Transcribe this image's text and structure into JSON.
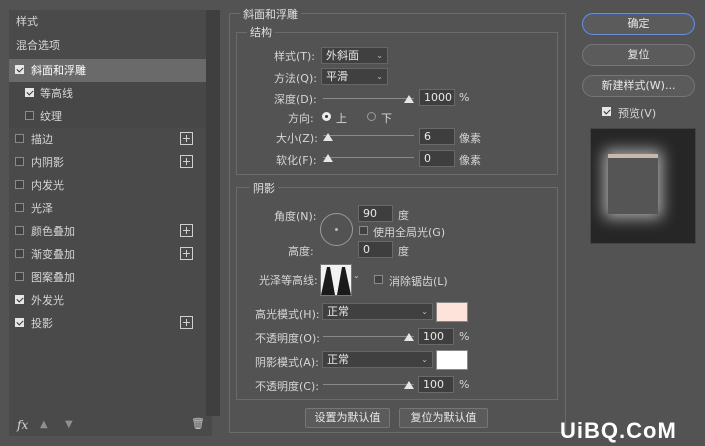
{
  "left_panel": {
    "header": "样式",
    "blend_options": "混合选项",
    "items": [
      {
        "label": "斜面和浮雕",
        "checked": true,
        "plus": false
      },
      {
        "label": "等高线",
        "checked": true,
        "plus": false
      },
      {
        "label": "纹理",
        "checked": false,
        "plus": false
      },
      {
        "label": "描边",
        "checked": false,
        "plus": true
      },
      {
        "label": "内阴影",
        "checked": false,
        "plus": true
      },
      {
        "label": "内发光",
        "checked": false,
        "plus": false
      },
      {
        "label": "光泽",
        "checked": false,
        "plus": false
      },
      {
        "label": "颜色叠加",
        "checked": false,
        "plus": true
      },
      {
        "label": "渐变叠加",
        "checked": false,
        "plus": true
      },
      {
        "label": "图案叠加",
        "checked": false,
        "plus": false
      },
      {
        "label": "外发光",
        "checked": true,
        "plus": false
      },
      {
        "label": "投影",
        "checked": true,
        "plus": true
      }
    ],
    "fx_label": "fx"
  },
  "bevel": {
    "section_title": "斜面和浮雕",
    "structure_title": "结构",
    "style_label": "样式(T):",
    "style_value": "外斜面",
    "technique_label": "方法(Q):",
    "technique_value": "平滑",
    "depth_label": "深度(D):",
    "depth_value": "1000",
    "depth_unit": "%",
    "direction_label": "方向:",
    "direction_up": "上",
    "direction_down": "下",
    "size_label": "大小(Z):",
    "size_value": "6",
    "size_unit": "像素",
    "soften_label": "软化(F):",
    "soften_value": "0",
    "soften_unit": "像素"
  },
  "shading": {
    "title": "阴影",
    "angle_label": "角度(N):",
    "angle_value": "90",
    "angle_unit": "度",
    "global_light_label": "使用全局光(G)",
    "altitude_label": "高度:",
    "altitude_value": "0",
    "altitude_unit": "度",
    "gloss_contour_label": "光泽等高线:",
    "anti_alias_label": "消除锯齿(L)",
    "highlight_mode_label": "高光模式(H):",
    "highlight_mode_value": "正常",
    "highlight_color": "#fde3d9",
    "highlight_opacity_label": "不透明度(O):",
    "highlight_opacity_value": "100",
    "highlight_opacity_unit": "%",
    "shadow_mode_label": "阴影模式(A):",
    "shadow_mode_value": "正常",
    "shadow_color": "#ffffff",
    "shadow_opacity_label": "不透明度(C):",
    "shadow_opacity_value": "100",
    "shadow_opacity_unit": "%"
  },
  "buttons": {
    "set_default": "设置为默认值",
    "reset_default": "复位为默认值",
    "ok": "确定",
    "reset": "复位",
    "new_style": "新建样式(W)...",
    "preview_label": "预览(V)"
  },
  "watermark": "UiBQ.CoM"
}
